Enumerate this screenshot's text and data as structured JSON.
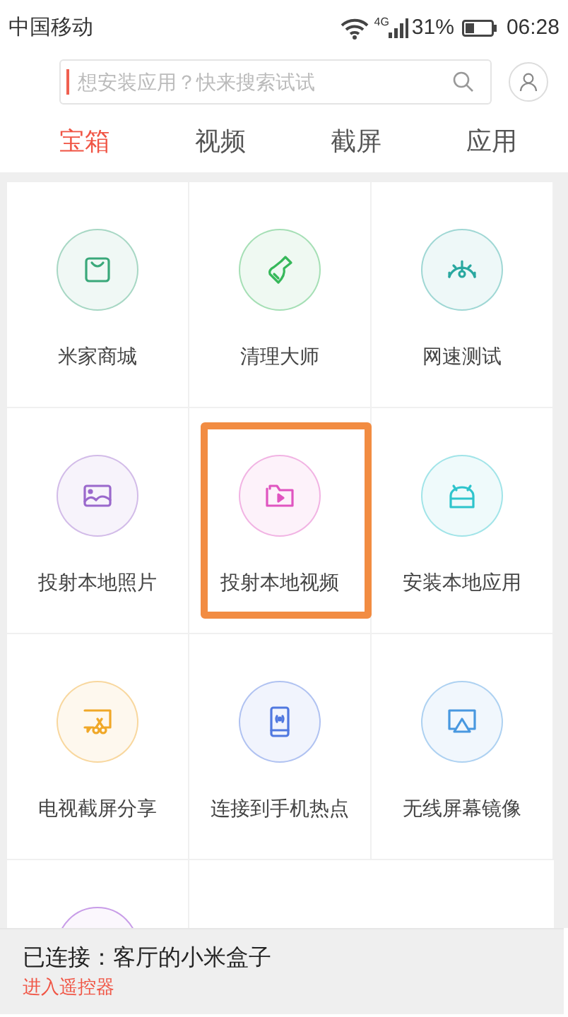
{
  "status_bar": {
    "carrier": "中国移动",
    "network": "4G",
    "battery": "31%",
    "time": "06:28"
  },
  "search": {
    "placeholder": "想安装应用？快来搜索试试"
  },
  "tabs": [
    {
      "label": "宝箱",
      "selected": true
    },
    {
      "label": "视频",
      "selected": false
    },
    {
      "label": "截屏",
      "selected": false
    },
    {
      "label": "应用",
      "selected": false
    }
  ],
  "tiles": [
    {
      "label": "米家商城",
      "color": "#3aa87a",
      "highlighted": false
    },
    {
      "label": "清理大师",
      "color": "#36b85a",
      "highlighted": false
    },
    {
      "label": "网速测试",
      "color": "#2aa8a0",
      "highlighted": false
    },
    {
      "label": "投射本地照片",
      "color": "#9a68cc",
      "highlighted": false
    },
    {
      "label": "投射本地视频",
      "color": "#e055c0",
      "highlighted": true
    },
    {
      "label": "安装本地应用",
      "color": "#2ec4cc",
      "highlighted": false
    },
    {
      "label": "电视截屏分享",
      "color": "#f0a828",
      "highlighted": false
    },
    {
      "label": "连接到手机热点",
      "color": "#5078e0",
      "highlighted": false
    },
    {
      "label": "无线屏幕镜像",
      "color": "#4898e0",
      "highlighted": false
    },
    {
      "color": "#c89ce8",
      "highlighted": false
    }
  ],
  "connection": {
    "status": "已连接：客厅的小米盒子",
    "link": "进入遥控器"
  }
}
